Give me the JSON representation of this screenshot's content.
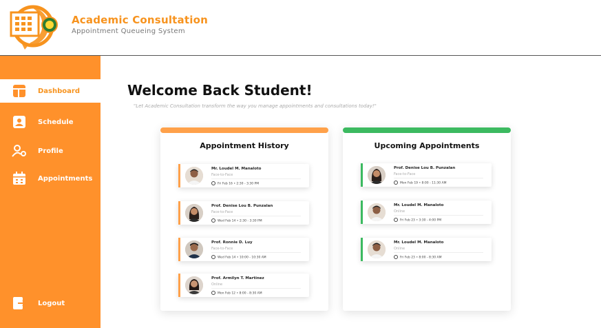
{
  "header": {
    "title": "Academic Consultation",
    "subtitle": "Appointment Queueing System"
  },
  "colors": {
    "brand": "#ff912b",
    "accent_orange": "#f7931e",
    "history_bar": "#ffa14a",
    "upcoming_bar": "#3cba60"
  },
  "sidebar": {
    "items": [
      {
        "label": "Dashboard",
        "icon": "dashboard-icon",
        "active": true
      },
      {
        "label": "Schedule",
        "icon": "calendar-person-icon"
      },
      {
        "label": "Profile",
        "icon": "user-gear-icon"
      },
      {
        "label": "Appointments",
        "icon": "calendar-icon"
      },
      {
        "label": "Logout",
        "icon": "logout-icon"
      }
    ]
  },
  "main": {
    "welcome": "Welcome Back Student!",
    "tagline": "\"Let Academic Consultation transform the way you manage appointments and consultations today!\""
  },
  "history": {
    "title": "Appointment History",
    "cards": [
      {
        "name": "Mr. Loudel M. Manaloto",
        "mode": "Face-to-Face",
        "when": "Fri Feb 16 • 2:30 - 3:30 PM"
      },
      {
        "name": "Prof. Denise Lou B. Punzalan",
        "mode": "Face-to-Face",
        "when": "Wed Feb 14 • 2:30 - 3:30 PM"
      },
      {
        "name": "Prof. Ronnie D. Luy",
        "mode": "Face-to-Face",
        "when": "Wed Feb 14 • 10:00 - 10:30 AM"
      },
      {
        "name": "Prof. Armilyn T. Martinez",
        "mode": "Online",
        "when": "Mon Feb 12 • 8:00 - 8:30 AM"
      }
    ]
  },
  "upcoming": {
    "title": "Upcoming Appointments",
    "cards": [
      {
        "name": "Prof. Denise Lou B. Punzalan",
        "mode": "Face-to-Face",
        "when": "Mon Feb 19 • 8:00 - 11:30 AM"
      },
      {
        "name": "Mr. Loudel M. Manaloto",
        "mode": "Online",
        "when": "Fri Feb 23 • 3:30 - 4:00 PM"
      },
      {
        "name": "Mr. Loudel M. Manaloto",
        "mode": "Online",
        "when": "Fri Feb 23 • 8:00 - 8:30 AM"
      }
    ]
  }
}
